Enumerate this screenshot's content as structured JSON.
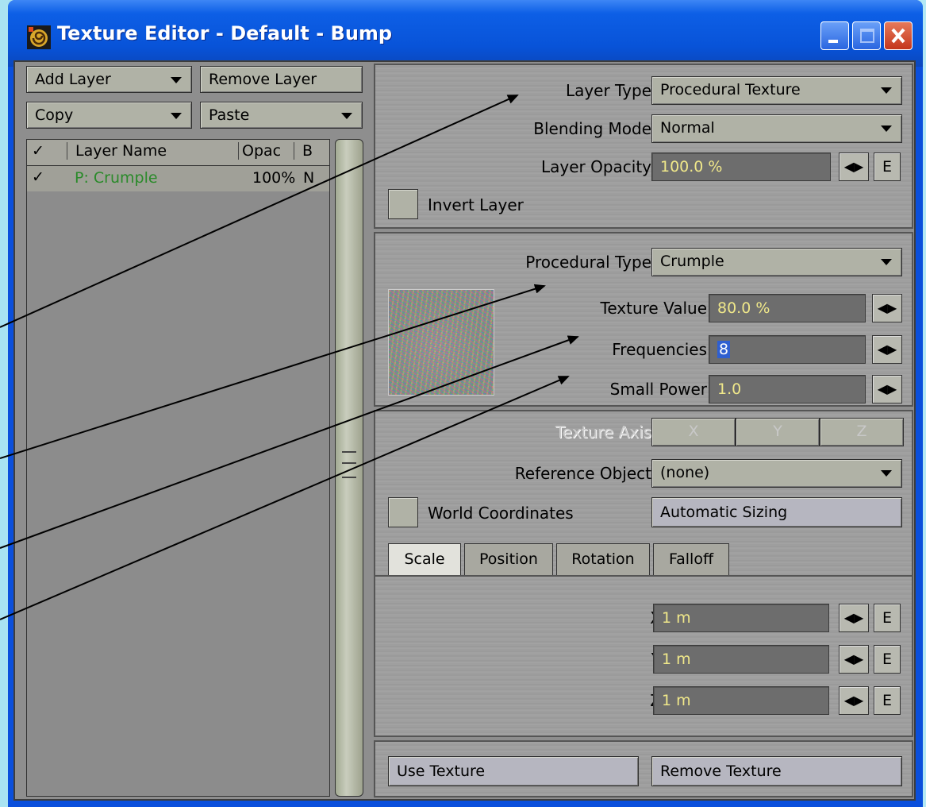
{
  "window": {
    "title": "Texture Editor - Default - Bump",
    "minimize_icon": "minimize-icon",
    "maximize_icon": "maximize-icon",
    "close_icon": "close-icon"
  },
  "left": {
    "add_layer": "Add Layer",
    "remove_layer": "Remove Layer",
    "copy": "Copy",
    "paste": "Paste",
    "table_headers": {
      "check": "✓",
      "name": "Layer Name",
      "opacity": "Opac",
      "blend": "B"
    },
    "rows": [
      {
        "check": "✓",
        "name": "P: Crumple",
        "opacity": "100%",
        "blend": "N"
      }
    ]
  },
  "layer": {
    "type_label": "Layer Type",
    "type_value": "Procedural Texture",
    "blend_label": "Blending Mode",
    "blend_value": "Normal",
    "opacity_label": "Layer Opacity",
    "opacity_value": "100.0 %",
    "e": "E",
    "invert_label": "Invert Layer"
  },
  "procedural": {
    "type_label": "Procedural Type",
    "type_value": "Crumple",
    "texture_value_label": "Texture Value",
    "texture_value": "80.0 %",
    "frequencies_label": "Frequencies",
    "frequencies_value": "8",
    "small_power_label": "Small Power",
    "small_power_value": "1.0"
  },
  "axis": {
    "label": "Texture Axis",
    "x": "X",
    "y": "Y",
    "z": "Z",
    "reference_label": "Reference Object",
    "reference_value": "(none)",
    "world_coords": "World Coordinates",
    "auto_sizing": "Automatic Sizing"
  },
  "tabs": [
    "Scale",
    "Position",
    "Rotation",
    "Falloff"
  ],
  "scale": {
    "x_label": "X",
    "x_value": "1 m",
    "y_label": "Y",
    "y_value": "1 m",
    "z_label": "Z",
    "z_value": "1 m"
  },
  "bottom": {
    "use_texture": "Use Texture",
    "remove_texture": "Remove Texture"
  },
  "colors": {
    "titlebar": "#0853d8",
    "background": "#a9e3f2",
    "field_text": "#f0e88a",
    "layer_name_green": "#2a8a2a"
  }
}
